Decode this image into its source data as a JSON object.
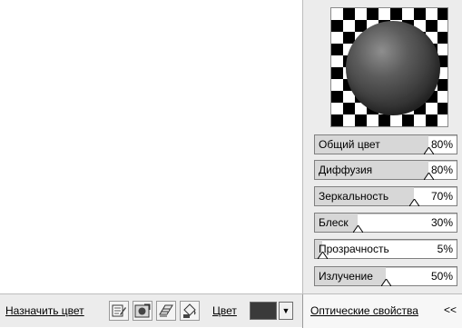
{
  "panel": {
    "sliders": [
      {
        "label": "Общий цвет",
        "value": "80%",
        "level": 0.8
      },
      {
        "label": "Диффузия",
        "value": "80%",
        "level": 0.8
      },
      {
        "label": "Зеркальность",
        "value": "70%",
        "level": 0.7
      },
      {
        "label": "Блеск",
        "value": "30%",
        "level": 0.3
      },
      {
        "label": "Прозрачность",
        "value": "5%",
        "level": 0.05
      },
      {
        "label": "Излучение",
        "value": "50%",
        "level": 0.5
      }
    ]
  },
  "toolbar": {
    "assign_color_label": "Назначить цвет",
    "color_label": "Цвет",
    "color_value": "#3a3a3a",
    "optics_tab_label": "Оптические свойства",
    "collapse_label": "<<"
  }
}
